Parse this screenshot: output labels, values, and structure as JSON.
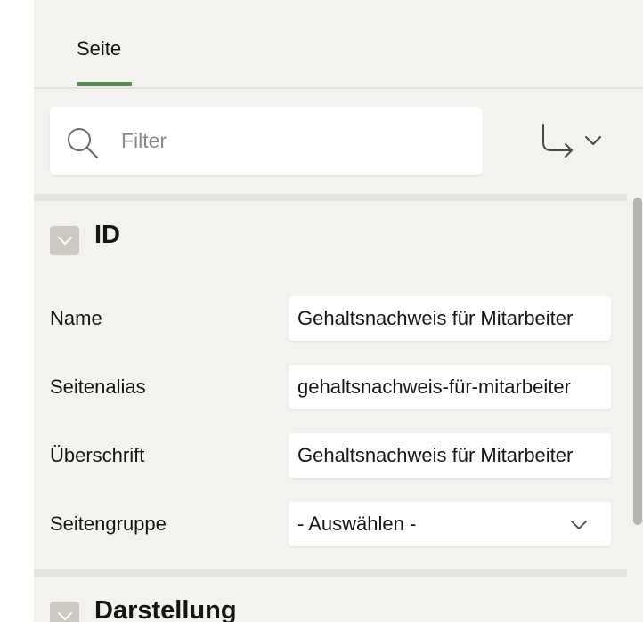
{
  "tabs": [
    {
      "label": "Seite",
      "active": true
    }
  ],
  "filter": {
    "placeholder": "Filter",
    "value": ""
  },
  "toolbar": {
    "goto_icon": "corner-down-right-arrow-icon",
    "dropdown_icon": "chevron-down-icon"
  },
  "sections": {
    "id": {
      "title": "ID",
      "fields": [
        {
          "label": "Name",
          "value": "Gehaltsnachweis für Mitarbeiter"
        },
        {
          "label": "Seitenalias",
          "value": "gehaltsnachweis-für-mitarbeiter"
        },
        {
          "label": "Überschrift",
          "value": "Gehaltsnachweis für Mitarbeiter"
        },
        {
          "label": "Seitengruppe",
          "value": "- Auswählen -",
          "type": "select"
        }
      ]
    },
    "darstellung": {
      "title": "Darstellung"
    }
  },
  "colors": {
    "panel_background": "#f3f2ee",
    "tab_accent": "#5a8a55",
    "collapse_box": "#cdcac3",
    "scrollbar_thumb": "#b4b2ac"
  }
}
